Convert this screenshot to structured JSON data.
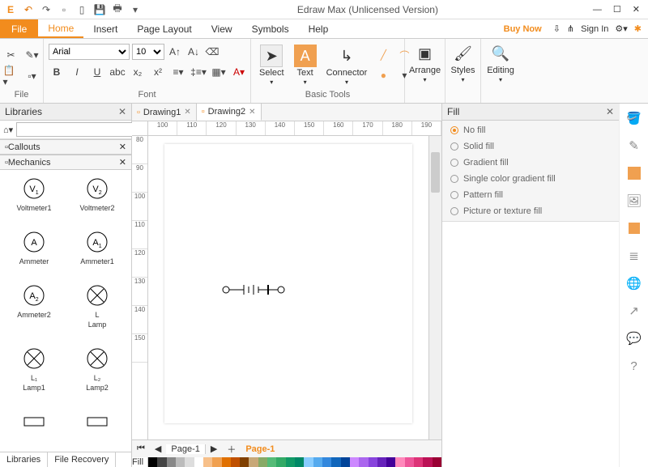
{
  "titlebar": {
    "title": "Edraw Max (Unlicensed Version)"
  },
  "qat": [
    "undo",
    "redo",
    "new",
    "open",
    "save",
    "print",
    "more"
  ],
  "menu": {
    "file": "File",
    "items": [
      "Home",
      "Insert",
      "Page Layout",
      "View",
      "Symbols",
      "Help"
    ],
    "active": 0,
    "buy": "Buy Now",
    "signin": "Sign In"
  },
  "ribbon": {
    "file_group": "File",
    "font_group": "Font",
    "basic_group": "Basic Tools",
    "arrange": "Arrange",
    "styles": "Styles",
    "editing": "Editing",
    "select": "Select",
    "text": "Text",
    "connector": "Connector",
    "font_name": "Arial",
    "font_size": "10"
  },
  "libraries": {
    "title": "Libraries",
    "callouts": "Callouts",
    "mechanics": "Mechanics",
    "shapes": [
      {
        "name": "Voltmeter1",
        "sym": "V",
        "sub": "1"
      },
      {
        "name": "Voltmeter2",
        "sym": "V",
        "sub": "2"
      },
      {
        "name": "Ammeter",
        "sym": "A",
        "sub": ""
      },
      {
        "name": "Ammeter1",
        "sym": "A",
        "sub": "1"
      },
      {
        "name": "Ammeter2",
        "sym": "A",
        "sub": "2"
      },
      {
        "name": "Lamp",
        "sym": "X",
        "sub": "",
        "label": "L"
      },
      {
        "name": "Lamp1",
        "sym": "X",
        "sub": "",
        "label": "L₁"
      },
      {
        "name": "Lamp2",
        "sym": "X",
        "sub": "",
        "label": "L₂"
      }
    ],
    "bottom_tabs": [
      "Libraries",
      "File Recovery"
    ]
  },
  "docs": {
    "tabs": [
      "Drawing1",
      "Drawing2"
    ],
    "active": 1,
    "page_tab": "Page-1",
    "page_orange": "Page-1"
  },
  "hruler": [
    "100",
    "110",
    "120",
    "130",
    "140",
    "150",
    "160",
    "170",
    "180",
    "190"
  ],
  "vruler": [
    "80",
    "90",
    "100",
    "110",
    "120",
    "130",
    "140",
    "150"
  ],
  "fill": {
    "title": "Fill",
    "opts": [
      "No fill",
      "Solid fill",
      "Gradient fill",
      "Single color gradient fill",
      "Pattern fill",
      "Picture or texture fill"
    ],
    "selected": 0
  },
  "colors": [
    "#000",
    "#444",
    "#888",
    "#bbb",
    "#ddd",
    "#fff",
    "#f7c08a",
    "#f0a050",
    "#e07000",
    "#c05000",
    "#804000",
    "#c8a878",
    "#8a6",
    "#5b7",
    "#3a6",
    "#196",
    "#086",
    "#8cf",
    "#5ae",
    "#38d",
    "#16b",
    "#049",
    "#c8f",
    "#a6e",
    "#84d",
    "#62b",
    "#409",
    "#f8b",
    "#e59",
    "#d37",
    "#b15",
    "#903"
  ]
}
